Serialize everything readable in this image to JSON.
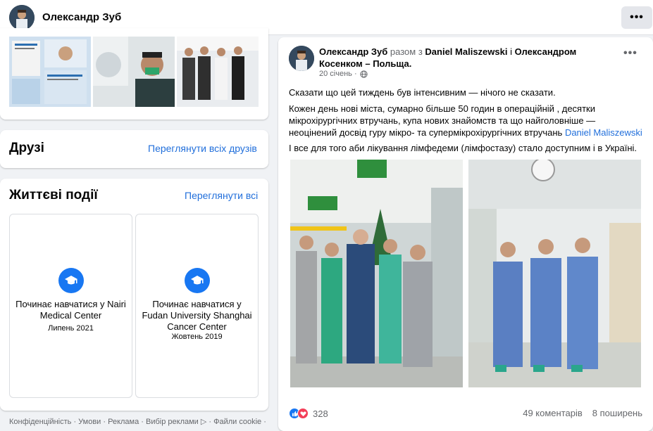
{
  "header": {
    "name": "Олександр Зуб",
    "more_label": "•••"
  },
  "friends": {
    "title": "Друзі",
    "link": "Переглянути всіх друзів"
  },
  "life_events": {
    "title": "Життєві події",
    "link": "Переглянути всі",
    "events": [
      {
        "title": "Починає навчатися у Nairi Medical Center",
        "date": "Липень 2021"
      },
      {
        "title": "Починає навчатися у Fudan University Shanghai Cancer Center",
        "date": "Жовтень 2019"
      }
    ]
  },
  "footer": {
    "text": "Конфіденційність · Умови · Реклама · Вибір реклами ▷ · Файли cookie ·"
  },
  "post": {
    "author": "Олександр Зуб",
    "with_word": "разом з",
    "tag1": "Daniel Maliszewski",
    "and_word": "і",
    "tag2": "Олександром Косенком",
    "location": "– Польща.",
    "date": "20 січень ·",
    "more_label": "•••",
    "para1": "Сказати що цей тиждень був інтенсивним — нічого не сказати.",
    "para2": "Кожен день нові міста, сумарно більше 50 годин в операційній , десятки мікрохірургічних втручань, купа нових знайомств та що найголовніше — неоцінений досвід гуру мікро- та супермікрохірургічних втручань",
    "para2_link": "Daniel Maliszewski",
    "para3": "І все для того аби лікування лімфедеми (лімфостазу) стало доступним і в Україні.",
    "reactions_count": "328",
    "comments": "49 коментарів",
    "shares": "8 поширень"
  },
  "colors": {
    "link": "#216fdb",
    "accent": "#1877f2",
    "muted": "#65676b"
  },
  "icons": [
    "more-icon",
    "graduation-cap-icon",
    "globe-icon",
    "like-icon",
    "love-icon"
  ]
}
